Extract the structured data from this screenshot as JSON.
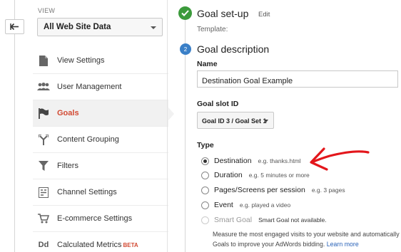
{
  "sidebar": {
    "view_label": "VIEW",
    "view_selected": "All Web Site Data",
    "items": [
      {
        "label": "View Settings",
        "icon": "document-icon",
        "active": false
      },
      {
        "label": "User Management",
        "icon": "users-icon",
        "active": false
      },
      {
        "label": "Goals",
        "icon": "flag-icon",
        "active": true
      },
      {
        "label": "Content Grouping",
        "icon": "grouping-icon",
        "active": false
      },
      {
        "label": "Filters",
        "icon": "filter-icon",
        "active": false
      },
      {
        "label": "Channel Settings",
        "icon": "channel-icon",
        "active": false
      },
      {
        "label": "E-commerce Settings",
        "icon": "cart-icon",
        "active": false
      },
      {
        "label": "Calculated Metrics",
        "icon": "dd-icon",
        "icon_text": "Dd",
        "active": false,
        "badge": "BETA"
      }
    ]
  },
  "goal_setup": {
    "title": "Goal set-up",
    "edit_label": "Edit",
    "template_label": "Template:"
  },
  "goal_description": {
    "step_number": "2",
    "title": "Goal description",
    "name_label": "Name",
    "name_value": "Destination Goal Example",
    "slot_label": "Goal slot ID",
    "slot_value": "Goal ID 3 / Goal Set 1",
    "type_label": "Type",
    "types": [
      {
        "label": "Destination",
        "hint": "e.g. thanks.html",
        "checked": true,
        "disabled": false
      },
      {
        "label": "Duration",
        "hint": "e.g. 5 minutes or more",
        "checked": false,
        "disabled": false
      },
      {
        "label": "Pages/Screens per session",
        "hint": "e.g. 3 pages",
        "checked": false,
        "disabled": false
      },
      {
        "label": "Event",
        "hint": "e.g. played a video",
        "checked": false,
        "disabled": false
      },
      {
        "label": "Smart Goal",
        "hint": "Smart Goal not available.",
        "checked": false,
        "disabled": true
      }
    ],
    "smart_desc_line1": "Measure the most engaged visits to your website and automatically t",
    "smart_desc_line2": "Goals to improve your AdWords bidding.",
    "learn_more": "Learn more"
  },
  "colors": {
    "accent_red": "#d24a33",
    "check_green": "#3b9a3b",
    "step_blue": "#3a7fc7",
    "annotation_red": "#e3161b"
  }
}
